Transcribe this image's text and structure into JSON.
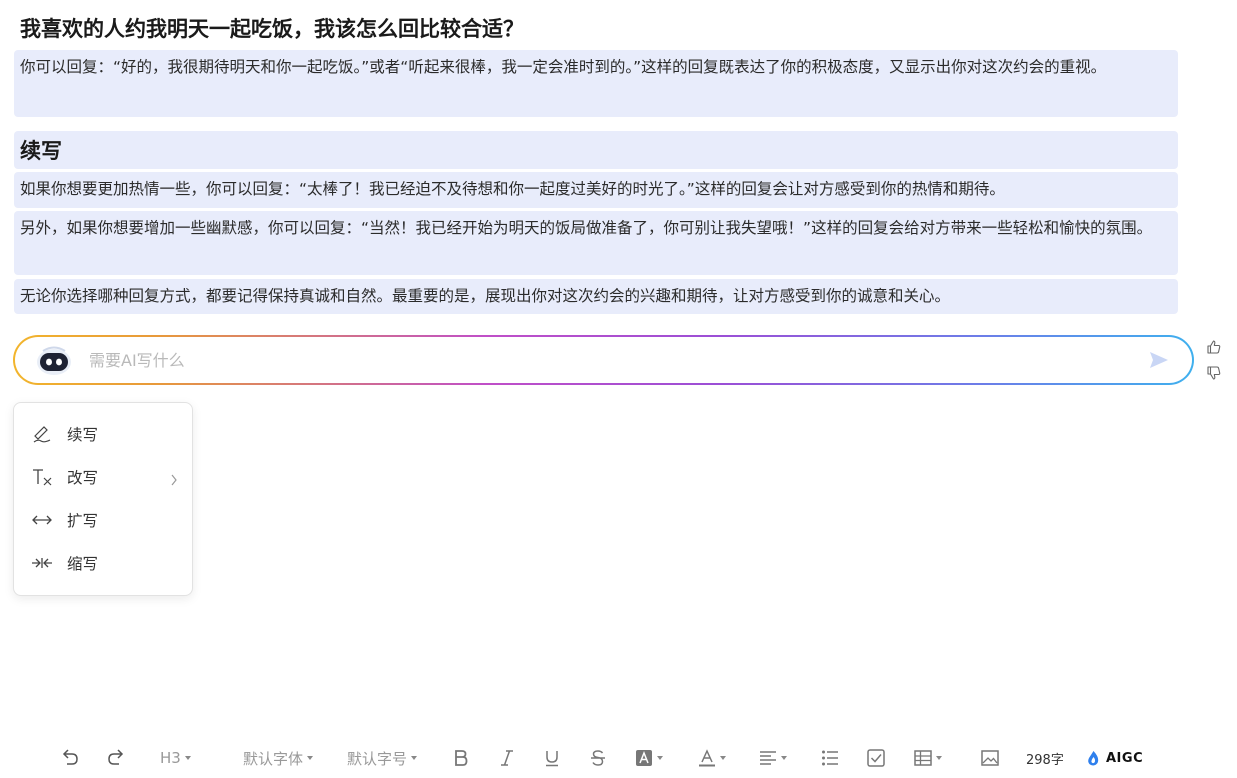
{
  "document": {
    "title": "我喜欢的人约我明天一起吃饭，我该怎么回比较合适？",
    "answer": "你可以回复：“好的，我很期待明天和你一起吃饭。”或者“听起来很棒，我一定会准时到的。”这样的回复既表达了你的积极态度，又显示出你对这次约会的重视。",
    "section_heading": "续写",
    "paragraphs": [
      "如果你想要更加热情一些，你可以回复：“太棒了！我已经迫不及待想和你一起度过美好的时光了。”这样的回复会让对方感受到你的热情和期待。",
      "另外，如果你想要增加一些幽默感，你可以回复：“当然！我已经开始为明天的饭局做准备了，你可别让我失望哦！”这样的回复会给对方带来一些轻松和愉快的氛围。",
      "无论你选择哪种回复方式，都要记得保持真诚和自然。最重要的是，展现出你对这次约会的兴趣和期待，让对方感受到你的诚意和关心。"
    ]
  },
  "ai_input": {
    "placeholder": "需要AI写什么",
    "value": ""
  },
  "menu": {
    "items": [
      {
        "label": "续写",
        "icon": "continue-write-icon"
      },
      {
        "label": "改写",
        "icon": "rewrite-icon",
        "has_submenu": true
      },
      {
        "label": "扩写",
        "icon": "expand-icon"
      },
      {
        "label": "缩写",
        "icon": "shrink-icon"
      }
    ]
  },
  "toolbar": {
    "heading_level": "H3",
    "font_family": "默认字体",
    "font_size": "默认字号",
    "word_count": "298字",
    "aigc_label": "AIGC"
  },
  "colors": {
    "highlight_bg": "#e8ecfb",
    "gradient_start": "#f2b52c",
    "gradient_mid": "#c04fc8",
    "gradient_end": "#3fb0ee",
    "send_icon": "#c9d6f5"
  }
}
